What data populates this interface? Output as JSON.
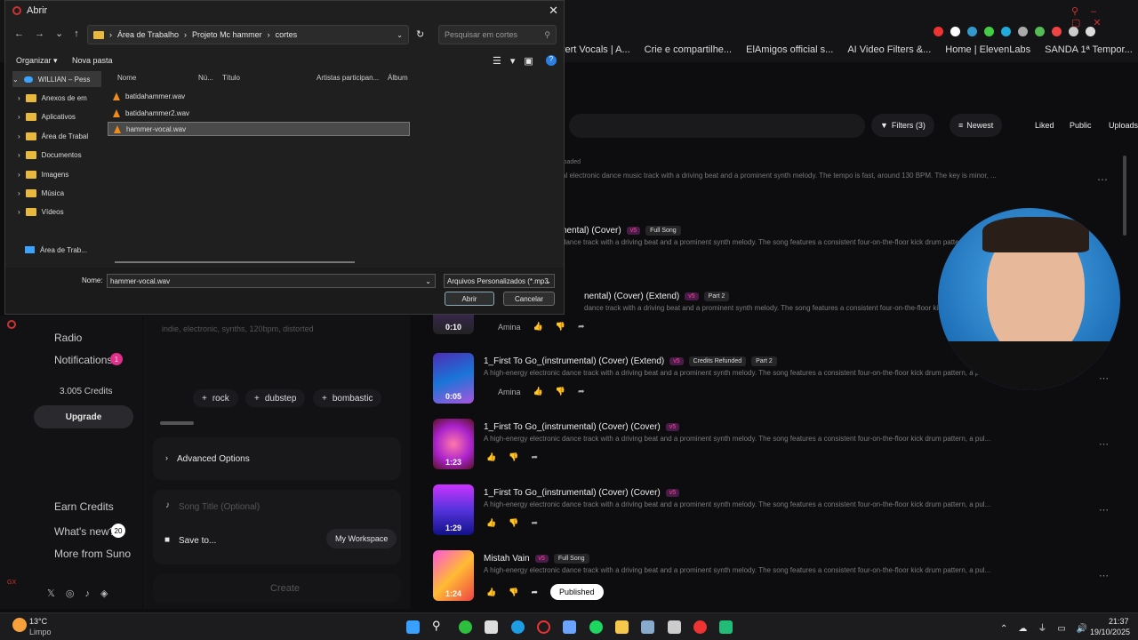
{
  "browser": {
    "bookmarks": [
      "vert Vocals | A...",
      "Crie e compartilhe...",
      "ElAmigos official s...",
      "AI Video Filters &...",
      "Home | ElevenLabs",
      "SANDA 1ª Tempor..."
    ]
  },
  "suno": {
    "nav": {
      "radio": "Radio",
      "notifications": "Notifications",
      "notif_count": "1",
      "credits": "3.005 Credits",
      "upgrade": "Upgrade",
      "earn": "Earn Credits",
      "whats_new": "What's new?",
      "whats_new_count": "20",
      "more": "More from Suno"
    },
    "style_placeholder": "indie, electronic, synths, 120bpm, distorted",
    "chips": [
      "rock",
      "dubstep",
      "bombastic"
    ],
    "advanced": "Advanced Options",
    "song_title_placeholder": "Song Title (Optional)",
    "save_to": "Save to...",
    "workspace": "My Workspace",
    "create": "Create",
    "filters": {
      "filters": "Filters (3)",
      "newest": "Newest",
      "liked": "Liked",
      "public": "Public",
      "uploads": "Uploads"
    },
    "uploaded_tag": "loaded",
    "top_desc": "al electronic dance music track with a driving beat and a prominent synth melody. The tempo is fast, around 130 BPM. The key is minor, ...",
    "songs": [
      {
        "title": "nental) (Cover)",
        "badge": "v5",
        "tag": "Full Song",
        "desc": "dance track with a driving beat and a prominent synth melody. The song features a consistent four-on-the-floor kick drum pattern, a pul...",
        "time": "",
        "artist": ""
      },
      {
        "title": "nental) (Cover) (Extend)",
        "badge": "v5",
        "tag": "Part 2",
        "desc": "dance track with a driving beat and a prominent synth melody. The song features a consistent four-on-the-floor kick drum pattern, a pul...",
        "time": "0:10",
        "artist": "Amina"
      },
      {
        "title": "1_First To Go_(instrumental) (Cover) (Extend)",
        "badge": "v5",
        "tag": "Credits Refunded",
        "tag2": "Part 2",
        "desc": "A high-energy electronic dance track with a driving beat and a prominent synth melody. The song features a consistent four-on-the-floor kick drum pattern, a pul...",
        "time": "0:05",
        "artist": "Amina"
      },
      {
        "title": "1_First To Go_(instrumental) (Cover) (Cover)",
        "badge": "v5",
        "desc": "A high-energy electronic dance track with a driving beat and a prominent synth melody. The song features a consistent four-on-the-floor kick drum pattern, a pul...",
        "time": "1:23"
      },
      {
        "title": "1_First To Go_(instrumental) (Cover) (Cover)",
        "badge": "v5",
        "desc": "A high-energy electronic dance track with a driving beat and a prominent synth melody. The song features a consistent four-on-the-floor kick drum pattern, a pul...",
        "time": "1:29"
      },
      {
        "title": "Mistah Vain",
        "badge": "v5",
        "tag": "Full Song",
        "desc": "A high-energy electronic dance track with a driving beat and a prominent synth melody. The song features a consistent four-on-the-floor kick drum pattern, a pul...",
        "time": "1:24",
        "published": "Published"
      }
    ]
  },
  "dialog": {
    "title": "Abrir",
    "path": [
      "Área de Trabalho",
      "Projeto Mc hammer",
      "cortes"
    ],
    "search_placeholder": "Pesquisar em cortes",
    "organize": "Organizar",
    "new_folder": "Nova pasta",
    "columns": [
      "Nome",
      "Nú...",
      "Título",
      "Artistas participan...",
      "Álbum"
    ],
    "tree": [
      "WILLIAN – Pess",
      "Anexos de em",
      "Aplicativos",
      "Área de Trabal",
      "Documentos",
      "Imagens",
      "Música",
      "Vídeos",
      "Área de Trab..."
    ],
    "files": [
      "batidahammer.wav",
      "batidahammer2.wav",
      "hammer-vocal.wav"
    ],
    "name_label": "Nome:",
    "name_value": "hammer-vocal.wav",
    "filter": "Arquivos Personalizados (*.mp3",
    "open": "Abrir",
    "cancel": "Cancelar"
  },
  "taskbar": {
    "temp": "13°C",
    "weather": "Limpo",
    "time": "21:37",
    "date": "19/10/2025"
  }
}
